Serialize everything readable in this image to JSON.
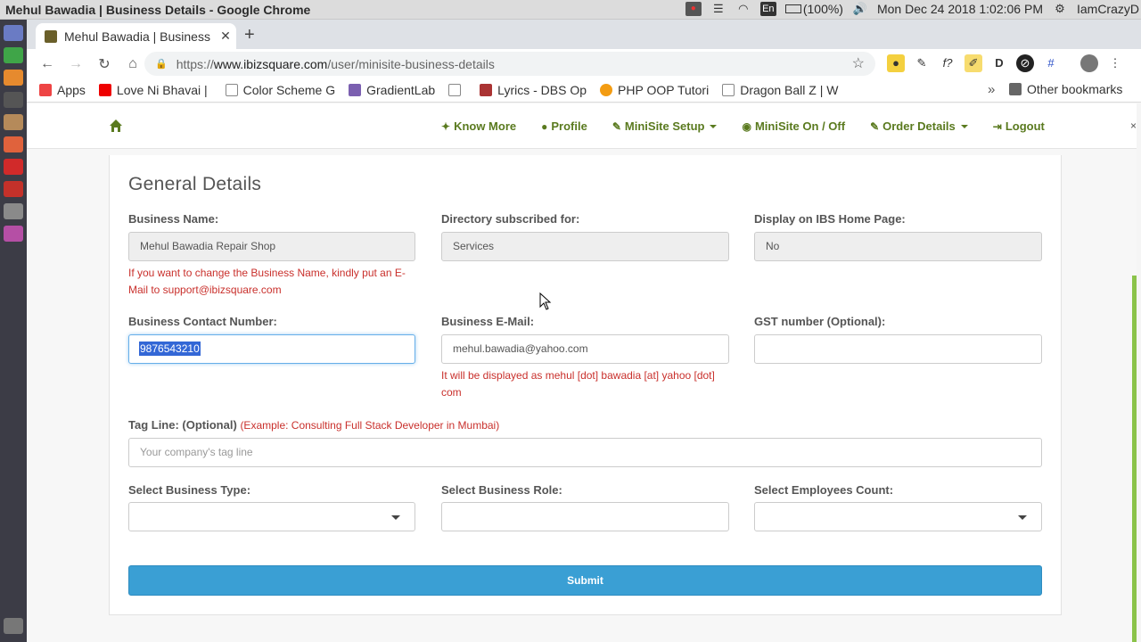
{
  "os": {
    "window_title": "Mehul Bawadia | Business Details - Google Chrome",
    "battery": "(100%)",
    "datetime": "Mon Dec 24 2018  1:02:06 PM",
    "user": "IamCrazyD",
    "lang": "En"
  },
  "browser": {
    "tab_title": "Mehul Bawadia | Business Details",
    "url_scheme": "https://",
    "url_host": "www.ibizsquare.com",
    "url_path": "/user/minisite-business-details",
    "bookmarks": [
      {
        "label": "Apps",
        "color": "#e44"
      },
      {
        "label": "Love Ni Bhavai |",
        "color": "#e00"
      },
      {
        "label": "Color Scheme G",
        "color": "#888"
      },
      {
        "label": "GradientLab",
        "color": "#7b5fb0"
      },
      {
        "label": "",
        "color": "#888"
      },
      {
        "label": "Lyrics - DBS Op",
        "color": "#a33"
      },
      {
        "label": "PHP OOP Tutori",
        "color": "#f39c12"
      },
      {
        "label": "Dragon Ball Z | W",
        "color": "#888"
      }
    ],
    "bookmarks_more": "»",
    "other_bookmarks": "Other bookmarks"
  },
  "site_nav": {
    "links": [
      {
        "label": "Know More",
        "icon": "lightbulb-icon",
        "glyph": "💡",
        "caret": false
      },
      {
        "label": "Profile",
        "icon": "user-icon",
        "glyph": "👤",
        "caret": false
      },
      {
        "label": "MiniSite Setup",
        "icon": "link-icon",
        "glyph": "🔗",
        "caret": true
      },
      {
        "label": "MiniSite On / Off",
        "icon": "globe-icon",
        "glyph": "🌐",
        "caret": false
      },
      {
        "label": "Order Details",
        "icon": "link-icon",
        "glyph": "🔗",
        "caret": true
      },
      {
        "label": "Logout",
        "icon": "logout-icon",
        "glyph": "⎋",
        "caret": false
      }
    ]
  },
  "form": {
    "title": "General Details",
    "business_name": {
      "label": "Business Name:",
      "value": "Mehul Bawadia Repair Shop"
    },
    "business_name_hint": "If you want to change the Business Name, kindly put an E-Mail to support@ibizsquare.com",
    "directory": {
      "label": "Directory subscribed for:",
      "value": "Services"
    },
    "display_home": {
      "label": "Display on IBS Home Page:",
      "value": "No"
    },
    "contact": {
      "label": "Business Contact Number:",
      "value": "9876543210"
    },
    "email": {
      "label": "Business E-Mail:",
      "value": "mehul.bawadia@yahoo.com"
    },
    "email_hint": "It will be displayed as mehul [dot] bawadia [at] yahoo [dot] com",
    "gst": {
      "label": "GST number (Optional):",
      "value": ""
    },
    "tagline": {
      "label": "Tag Line: (Optional)",
      "example": "(Example: Consulting Full Stack Developer in Mumbai)",
      "placeholder": "Your company's tag line"
    },
    "business_type": {
      "label": "Select Business Type:",
      "value": ""
    },
    "business_role": {
      "label": "Select Business Role:",
      "value": ""
    },
    "employees": {
      "label": "Select Employees Count:",
      "value": ""
    },
    "submit_label": "Submit"
  },
  "colors": {
    "nav_green": "#5a7a1f",
    "error_red": "#c9302c",
    "submit_blue": "#3a9fd4"
  }
}
